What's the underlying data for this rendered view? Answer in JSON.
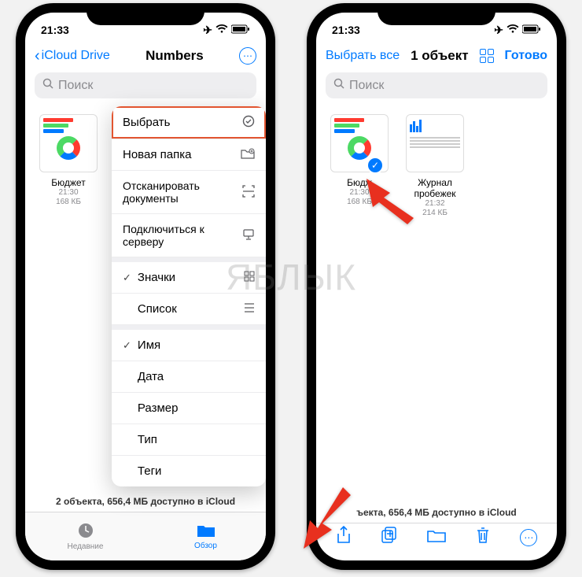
{
  "status": {
    "time": "21:33"
  },
  "watermark": "ЯБЛЫК",
  "phone1": {
    "nav": {
      "back": "iCloud Drive",
      "title": "Numbers"
    },
    "search_placeholder": "Поиск",
    "files": [
      {
        "name": "Бюджет",
        "time": "21:30",
        "size": "168 КБ"
      }
    ],
    "footer": "2 объекта, 656,4 МБ доступно в iCloud",
    "tabs": {
      "recent": "Недавние",
      "browse": "Обзор"
    },
    "menu": {
      "select": "Выбрать",
      "new_folder": "Новая папка",
      "scan": "Отсканировать документы",
      "connect": "Подключиться к серверу",
      "icons": "Значки",
      "list": "Список",
      "name": "Имя",
      "date": "Дата",
      "size": "Размер",
      "type": "Тип",
      "tags": "Теги"
    }
  },
  "phone2": {
    "nav": {
      "select_all": "Выбрать все",
      "title": "1 объект",
      "done": "Готово"
    },
    "search_placeholder": "Поиск",
    "files": [
      {
        "name": "Бюдж",
        "time": "21:30",
        "size": "168 КБ"
      },
      {
        "name": "Журнал пробежек",
        "time": "21:32",
        "size": "214 КБ"
      }
    ],
    "footer": "ъекта, 656,4 МБ доступно в iCloud"
  }
}
